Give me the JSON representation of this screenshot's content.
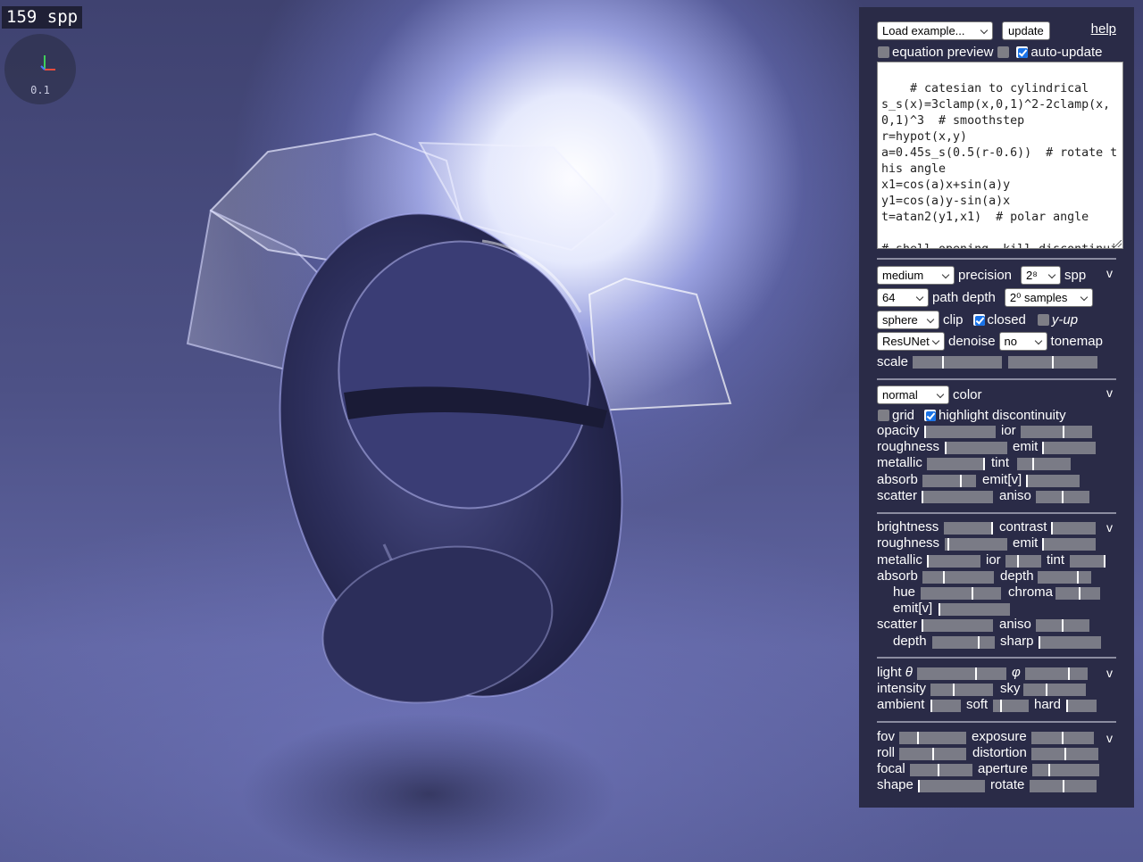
{
  "render": {
    "spp_counter": "159 spp",
    "gizmo_scale": "0.1"
  },
  "header": {
    "load_example": "Load example...",
    "update": "update",
    "help": "help",
    "equation_preview": "equation preview",
    "auto_update": "auto-update",
    "equation_preview_checked": false,
    "blank_checked": false,
    "auto_update_checked": true
  },
  "equation": {
    "text": "# catesian to cylindrical\ns_s(x)=3clamp(x,0,1)^2-2clamp(x,0,1)^3  # smoothstep\nr=hypot(x,y)\na=0.45s_s(0.5(r-0.6))  # rotate this angle\nx1=cos(a)x+sin(a)y\ny1=cos(a)y-sin(a)x\nt=atan2(y1,x1)  # polar angle\n\n# shell opening, kill discontinuities of the spiral"
  },
  "render_settings": {
    "precision_value": "medium",
    "precision_label": "precision",
    "spp_value": "2⁸",
    "spp_label": "spp",
    "path_depth_value": "64",
    "path_depth_label": "path depth",
    "samples_value": "2⁰ samples",
    "clip_value": "sphere",
    "clip_label": "clip",
    "closed_label": "closed",
    "closed_checked": true,
    "yup_label": "y-up",
    "yup_checked": false,
    "denoise_value": "ResUNet",
    "denoise_label": "denoise",
    "tonemap_value": "no",
    "tonemap_label": "tonemap",
    "scale_label": "scale",
    "collapse": "v"
  },
  "material": {
    "color_value": "normal",
    "color_label": "color",
    "grid_label": "grid",
    "grid_checked": false,
    "highlight_label": "highlight discontinuity",
    "highlight_checked": true,
    "collapse": "v",
    "labels": {
      "opacity": "opacity",
      "ior": "ior",
      "roughness": "roughness",
      "emit": "emit",
      "metallic": "metallic",
      "tint": "tint",
      "absorb": "absorb",
      "emit_v": "emit[v]",
      "scatter": "scatter",
      "aniso": "aniso"
    }
  },
  "volume": {
    "collapse": "v",
    "labels": {
      "brightness": "brightness",
      "contrast": "contrast",
      "roughness": "roughness",
      "emit": "emit",
      "metallic": "metallic",
      "ior": "ior",
      "tint": "tint",
      "absorb": "absorb",
      "depth": "depth",
      "hue": "hue",
      "chroma": "chroma",
      "emit_v": "emit[v]",
      "scatter": "scatter",
      "aniso": "aniso",
      "depth2": "depth",
      "sharp": "sharp"
    }
  },
  "lighting": {
    "collapse": "v",
    "light_label": "light",
    "theta": "θ",
    "phi": "φ",
    "labels": {
      "intensity": "intensity",
      "sky": "sky",
      "ambient": "ambient",
      "soft": "soft",
      "hard": "hard"
    }
  },
  "camera": {
    "collapse": "v",
    "labels": {
      "fov": "fov",
      "exposure": "exposure",
      "roll": "roll",
      "distortion": "distortion",
      "focal": "focal",
      "aperture": "aperture",
      "shape": "shape",
      "rotate": "rotate"
    }
  },
  "sliders": {
    "scale_a": 0.34,
    "scale_b": 0.5,
    "opacity": 0.0,
    "ior": 0.6,
    "roughness": 0.0,
    "emit": 0.0,
    "metallic": 1.0,
    "tint": 0.3,
    "absorb": 0.72,
    "emit_v": 0.0,
    "scatter": 0.0,
    "aniso": 0.5,
    "brightness": 1.0,
    "contrast": 0.0,
    "v_roughness": 0.05,
    "v_emit": 0.0,
    "v_metallic": 0.0,
    "v_ior": 0.35,
    "v_tint": 1.0,
    "v_absorb": 0.3,
    "v_depth": 0.75,
    "hue": 0.65,
    "chroma": 0.55,
    "v_emit_v": 0.0,
    "v_scatter": 0.0,
    "v_aniso": 0.5,
    "depth2": 0.75,
    "sharp": 0.0,
    "light_theta": 0.66,
    "light_phi": 0.7,
    "intensity": 0.37,
    "sky": 0.37,
    "ambient": 0.0,
    "soft": 0.2,
    "hard": 0.0,
    "fov": 0.27,
    "exposure": 0.5,
    "roll": 0.5,
    "distortion": 0.5,
    "focal": 0.45,
    "aperture": 0.25,
    "shape": 0.0,
    "rotate": 0.5
  }
}
